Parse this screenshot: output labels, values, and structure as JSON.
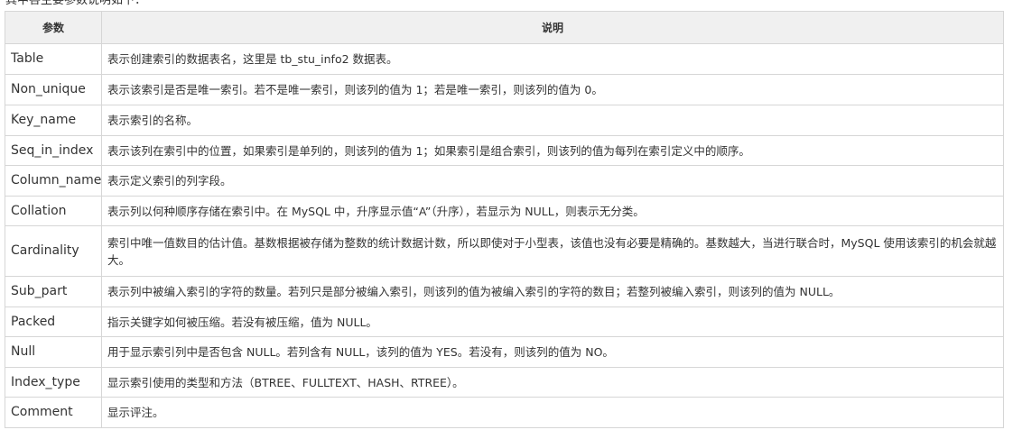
{
  "intro_text": "其中各主要参数说明如下：",
  "table": {
    "headers": [
      "参数",
      "说明"
    ],
    "rows": [
      {
        "param": "Table",
        "desc": "表示创建索引的数据表名，这里是 tb_stu_info2 数据表。"
      },
      {
        "param": "Non_unique",
        "desc": "表示该索引是否是唯一索引。若不是唯一索引，则该列的值为 1；若是唯一索引，则该列的值为 0。"
      },
      {
        "param": "Key_name",
        "desc": "表示索引的名称。"
      },
      {
        "param": "Seq_in_index",
        "desc": "表示该列在索引中的位置，如果索引是单列的，则该列的值为 1；如果索引是组合索引，则该列的值为每列在索引定义中的顺序。"
      },
      {
        "param": "Column_name",
        "desc": "表示定义索引的列字段。"
      },
      {
        "param": "Collation",
        "desc": "表示列以何种顺序存储在索引中。在 MySQL 中，升序显示值“A”（升序），若显示为 NULL，则表示无分类。"
      },
      {
        "param": "Cardinality",
        "desc": "索引中唯一值数目的估计值。基数根据被存储为整数的统计数据计数，所以即使对于小型表，该值也没有必要是精确的。基数越大，当进行联合时，MySQL 使用该索引的机会就越大。"
      },
      {
        "param": "Sub_part",
        "desc": "表示列中被编入索引的字符的数量。若列只是部分被编入索引，则该列的值为被编入索引的字符的数目；若整列被编入索引，则该列的值为 NULL。"
      },
      {
        "param": "Packed",
        "desc": "指示关键字如何被压缩。若没有被压缩，值为 NULL。"
      },
      {
        "param": "Null",
        "desc": "用于显示索引列中是否包含 NULL。若列含有 NULL，该列的值为 YES。若没有，则该列的值为 NO。"
      },
      {
        "param": "Index_type",
        "desc": "显示索引使用的类型和方法（BTREE、FULLTEXT、HASH、RTREE）。"
      },
      {
        "param": "Comment",
        "desc": "显示评注。"
      }
    ]
  }
}
